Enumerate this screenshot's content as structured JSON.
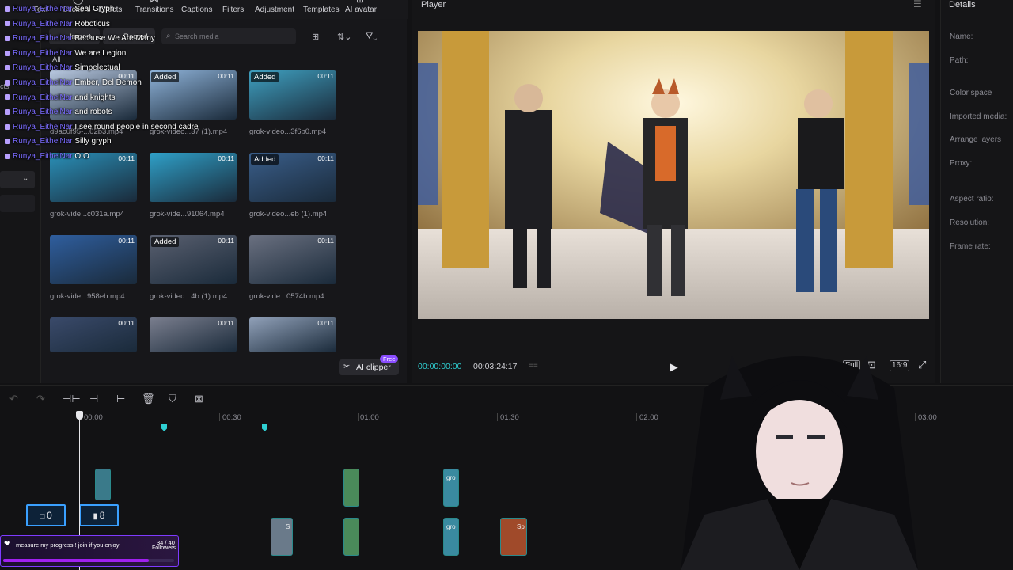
{
  "toolbar": {
    "tabs": [
      "Text",
      "Stickers",
      "Effects",
      "Transitions",
      "Captions",
      "Filters",
      "Adjustment",
      "Templates",
      "AI avatar"
    ],
    "side_label": "cts"
  },
  "media": {
    "import_label": "Import",
    "record_label": "Record",
    "search_placeholder": "Search media",
    "all_label": "All",
    "ai_clipper": "AI clipper",
    "free_tag": "Free",
    "items": [
      {
        "label": "d9ac0f95-...02b3.mp4",
        "added": false,
        "duration": "00:11"
      },
      {
        "label": "grok-video...37 (1).mp4",
        "added": true,
        "duration": "00:11"
      },
      {
        "label": "grok-video...3f6b0.mp4",
        "added": true,
        "duration": "00:11"
      },
      {
        "label": "grok-vide...c031a.mp4",
        "added": false,
        "duration": "00:11"
      },
      {
        "label": "grok-vide...91064.mp4",
        "added": false,
        "duration": "00:11"
      },
      {
        "label": "grok-video...eb (1).mp4",
        "added": true,
        "duration": "00:11"
      },
      {
        "label": "grok-vide...958eb.mp4",
        "added": false,
        "duration": "00:11"
      },
      {
        "label": "grok-video...4b (1).mp4",
        "added": true,
        "duration": "00:11"
      },
      {
        "label": "grok-vide...0574b.mp4",
        "added": false,
        "duration": "00:11"
      },
      {
        "label": "",
        "added": false,
        "duration": "00:11"
      },
      {
        "label": "",
        "added": false,
        "duration": "00:11"
      },
      {
        "label": "",
        "added": false,
        "duration": "00:11"
      }
    ],
    "colors": [
      "#b8c8e0",
      "#8fb3d9",
      "#3fa0c0",
      "#2a90b8",
      "#2fa0c8",
      "#3a5e8a",
      "#2f5e9e",
      "#5a6070",
      "#6a7080",
      "#3a4a6a",
      "#7a7e8e",
      "#90a0b8"
    ]
  },
  "player": {
    "title": "Player",
    "time_current": "00:00:00:00",
    "time_total": "00:03:24:17",
    "btn_full": "Full",
    "btn_ratio": "16:9"
  },
  "details": {
    "title": "Details",
    "rows": [
      "Name:",
      "Path:",
      "Color space",
      "Imported media:",
      "Arrange layers",
      "Proxy:",
      "Aspect ratio:",
      "Resolution:",
      "Frame rate:"
    ]
  },
  "timeline": {
    "ruler": [
      "00:00",
      "00:30",
      "01:00",
      "01:30",
      "02:00",
      "03:00"
    ],
    "track_a": "0",
    "track_b": "8",
    "clip_labels": [
      "gro",
      "S",
      "gro",
      "Sp"
    ]
  },
  "chat": [
    {
      "user": "Runya_EithelNar",
      "msg": "Seal Gryph"
    },
    {
      "user": "Runya_EithelNar",
      "msg": "Roboticus"
    },
    {
      "user": "Runya_EithelNar",
      "msg": "Because We Are Many"
    },
    {
      "user": "Runya_EithelNar",
      "msg": "We are Legion"
    },
    {
      "user": "Runya_EithelNar",
      "msg": "Simpelectual"
    },
    {
      "user": "Runya_EithelNar",
      "msg": "Ember, Del Demon"
    },
    {
      "user": "Runya_EithelNar",
      "msg": "and knights"
    },
    {
      "user": "Runya_EithelNar",
      "msg": "and robots"
    },
    {
      "user": "Runya_EithelNar",
      "msg": "I see round people in second cadre"
    },
    {
      "user": "Runya_EithelNar",
      "msg": "Silly gryph"
    },
    {
      "user": "Runya_EithelNar",
      "msg": "O.O"
    }
  ],
  "goal": {
    "text": "measure my progress ! join if you enjoy!",
    "count": "34 / 40",
    "label": "Followers",
    "progress": 0.85
  }
}
